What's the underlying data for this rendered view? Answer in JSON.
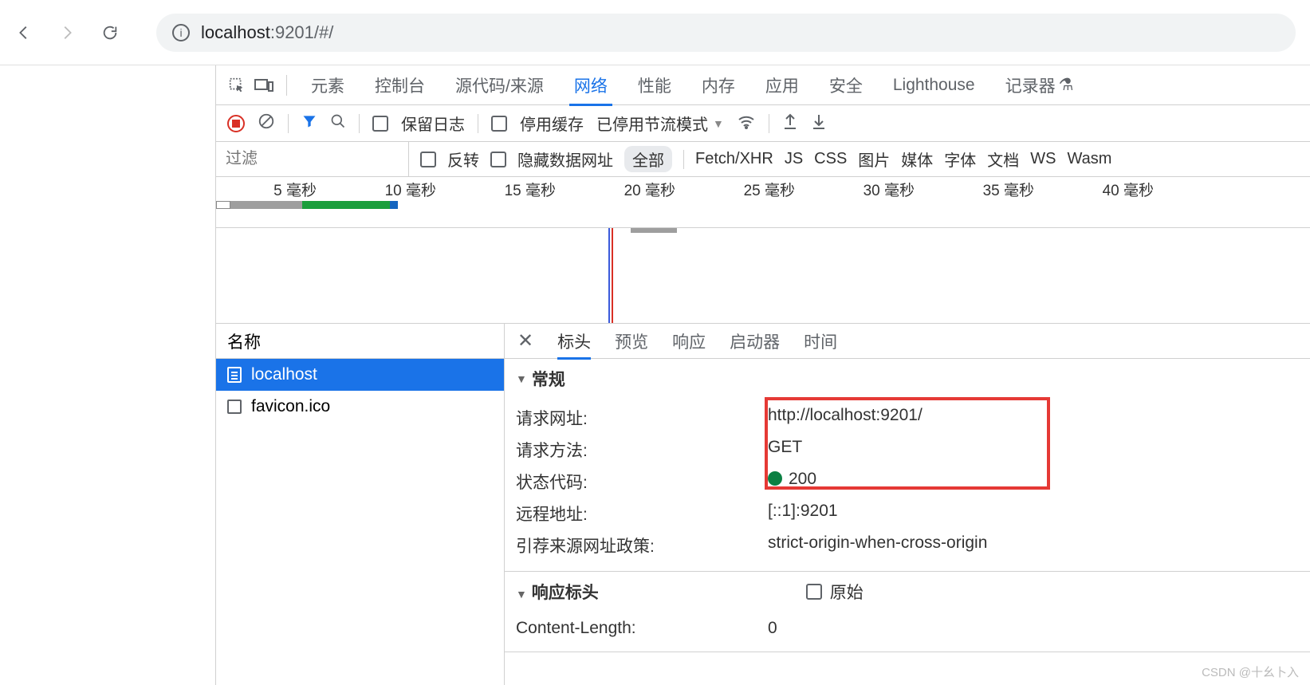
{
  "browser": {
    "url_host": "localhost",
    "url_rest": ":9201/#/"
  },
  "devtools": {
    "tabs": [
      "元素",
      "控制台",
      "源代码/来源",
      "网络",
      "性能",
      "内存",
      "应用",
      "安全",
      "Lighthouse",
      "记录器"
    ],
    "active_tab": "网络",
    "toolbar": {
      "preserve_log": "保留日志",
      "disable_cache": "停用缓存",
      "throttling": "已停用节流模式"
    },
    "filter": {
      "placeholder": "过滤",
      "invert": "反转",
      "hide_data_urls": "隐藏数据网址",
      "all": "全部",
      "types": [
        "Fetch/XHR",
        "JS",
        "CSS",
        "图片",
        "媒体",
        "字体",
        "文档",
        "WS",
        "Wasm"
      ]
    },
    "timeline_ticks": [
      "5 毫秒",
      "10 毫秒",
      "15 毫秒",
      "20 毫秒",
      "25 毫秒",
      "30 毫秒",
      "35 毫秒",
      "40 毫秒"
    ],
    "requests": {
      "header": "名称",
      "items": [
        {
          "name": "localhost",
          "selected": true,
          "type": "doc"
        },
        {
          "name": "favicon.ico",
          "selected": false,
          "type": "other"
        }
      ]
    },
    "detail": {
      "tabs": [
        "标头",
        "预览",
        "响应",
        "启动器",
        "时间"
      ],
      "active": "标头",
      "general": {
        "title": "常规",
        "rows": [
          {
            "k": "请求网址:",
            "v": "http://localhost:9201/"
          },
          {
            "k": "请求方法:",
            "v": "GET"
          },
          {
            "k": "状态代码:",
            "v": "200",
            "status": true
          },
          {
            "k": "远程地址:",
            "v": "[::1]:9201"
          },
          {
            "k": "引荐来源网址政策:",
            "v": "strict-origin-when-cross-origin"
          }
        ]
      },
      "response_headers": {
        "title": "响应标头",
        "raw_label": "原始",
        "rows": [
          {
            "k": "Content-Length:",
            "v": "0"
          }
        ]
      }
    }
  },
  "watermark": "CSDN @十幺卜入"
}
